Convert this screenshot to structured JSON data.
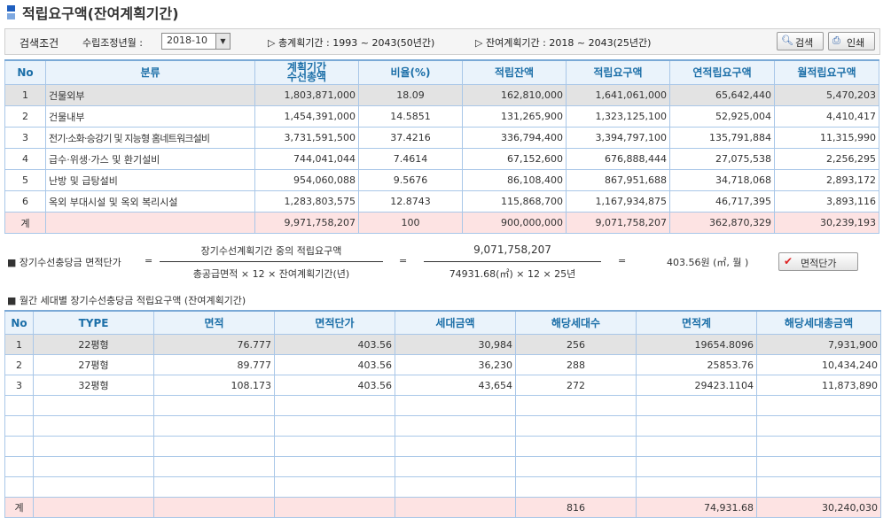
{
  "title": "적립요구액(잔여계획기간)",
  "search": {
    "label": "검색조건",
    "period_label": "수립조정년월 :",
    "period_value": "2018-10",
    "total_period": "▷ 총계획기간 : 1993 ~ 2043(50년간)",
    "remaining_period": "▷ 잔여계획기간 :  2018 ~ 2043(25년간)",
    "search_button": "검색",
    "print_button": "인쇄"
  },
  "table1": {
    "headers": [
      "No",
      "분류",
      "계획기간\n수선총액",
      "비율(%)",
      "적립잔액",
      "적립요구액",
      "연적립요구액",
      "월적립요구액"
    ],
    "rows": [
      [
        "1",
        "건물외부",
        "1,803,871,000",
        "18.09",
        "162,810,000",
        "1,641,061,000",
        "65,642,440",
        "5,470,203"
      ],
      [
        "2",
        "건물내부",
        "1,454,391,000",
        "14.5851",
        "131,265,900",
        "1,323,125,100",
        "52,925,004",
        "4,410,417"
      ],
      [
        "3",
        "전기·소화·승강기 및 지능형 홈네트워크설비",
        "3,731,591,500",
        "37.4216",
        "336,794,400",
        "3,394,797,100",
        "135,791,884",
        "11,315,990"
      ],
      [
        "4",
        "급수·위생·가스 및 환기설비",
        "744,041,044",
        "7.4614",
        "67,152,600",
        "676,888,444",
        "27,075,538",
        "2,256,295"
      ],
      [
        "5",
        "난방 및 급탕설비",
        "954,060,088",
        "9.5676",
        "86,108,400",
        "867,951,688",
        "34,718,068",
        "2,893,172"
      ],
      [
        "6",
        "옥외 부대시설 및 옥외 복리시설",
        "1,283,803,575",
        "12.8743",
        "115,868,700",
        "1,167,934,875",
        "46,717,395",
        "3,893,116"
      ]
    ],
    "total": [
      "계",
      "",
      "9,971,758,207",
      "100",
      "900,000,000",
      "9,071,758,207",
      "362,870,329",
      "30,239,193"
    ]
  },
  "formula": {
    "label": "■ 장기수선충당금 면적단가",
    "eq": "=",
    "num1": "장기수선계획기간 중의 적립요구액",
    "den1": "총공급면적 × 12 × 잔여계획기간(년)",
    "num2": "9,071,758,207",
    "den2": "74931.68(㎡)   × 12 × 25년",
    "result": "403.56원 (㎡, 월 )",
    "unit_button": "면적단가"
  },
  "section2_title": "■ 월간 세대별 장기수선충당금 적립요구액 (잔여계획기간)",
  "table2": {
    "headers": [
      "No",
      "TYPE",
      "면적",
      "면적단가",
      "세대금액",
      "해당세대수",
      "면적계",
      "해당세대총금액"
    ],
    "rows": [
      [
        "1",
        "22평형",
        "76.777",
        "403.56",
        "30,984",
        "256",
        "19654.8096",
        "7,931,900"
      ],
      [
        "2",
        "27평형",
        "89.777",
        "403.56",
        "36,230",
        "288",
        "25853.76",
        "10,434,240"
      ],
      [
        "3",
        "32평형",
        "108.173",
        "403.56",
        "43,654",
        "272",
        "29423.1104",
        "11,873,890"
      ]
    ],
    "total": [
      "계",
      "",
      "",
      "",
      "",
      "816",
      "74,931.68",
      "30,240,030"
    ]
  }
}
